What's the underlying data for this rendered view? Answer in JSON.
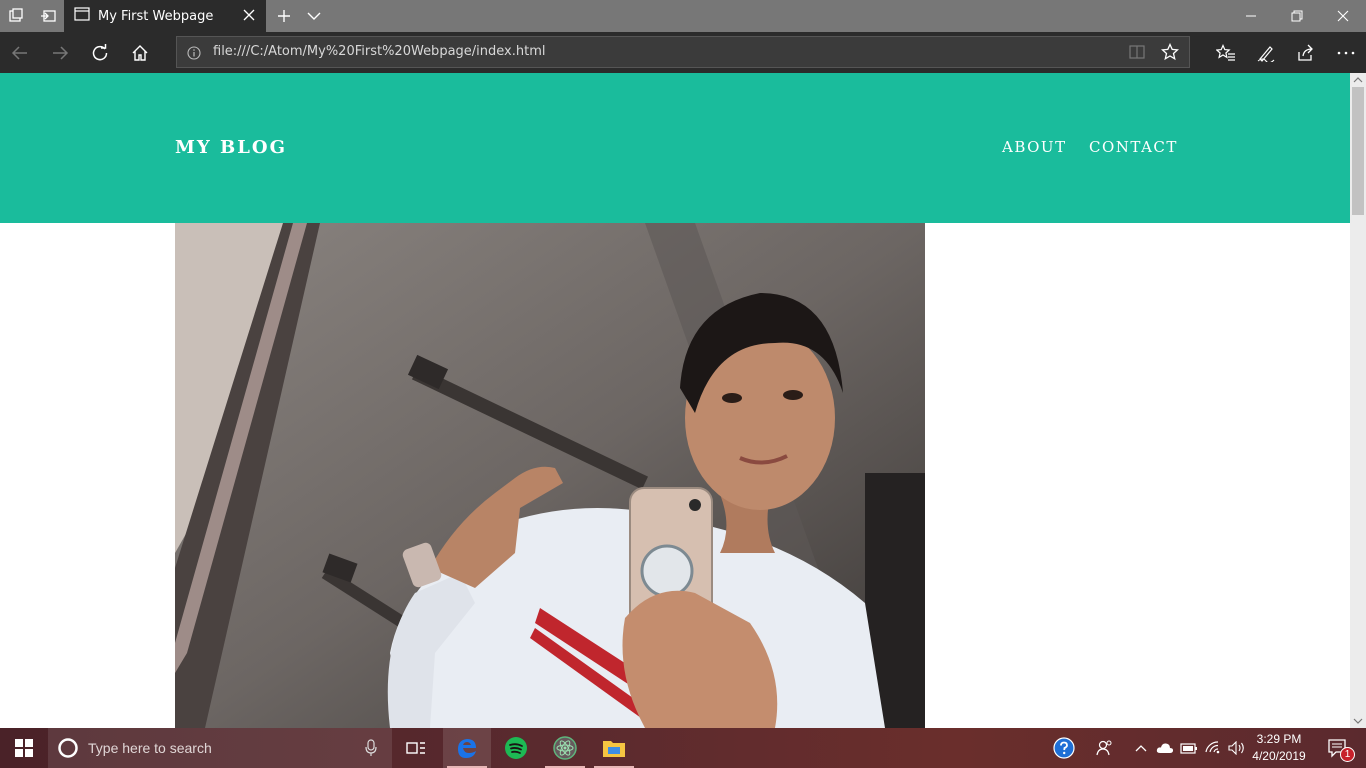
{
  "browser": {
    "tab_title": "My First Webpage",
    "url": "file:///C:/Atom/My%20First%20Webpage/index.html"
  },
  "site": {
    "title": "MY BLOG",
    "nav": [
      {
        "label": "ABOUT"
      },
      {
        "label": "CONTACT"
      }
    ],
    "header_color": "#1abc9c"
  },
  "taskbar": {
    "search_placeholder": "Type here to search",
    "time": "3:29 PM",
    "date": "4/20/2019",
    "notification_count": "1",
    "apps": [
      "task-view",
      "edge",
      "spotify",
      "atom",
      "file-explorer"
    ]
  }
}
